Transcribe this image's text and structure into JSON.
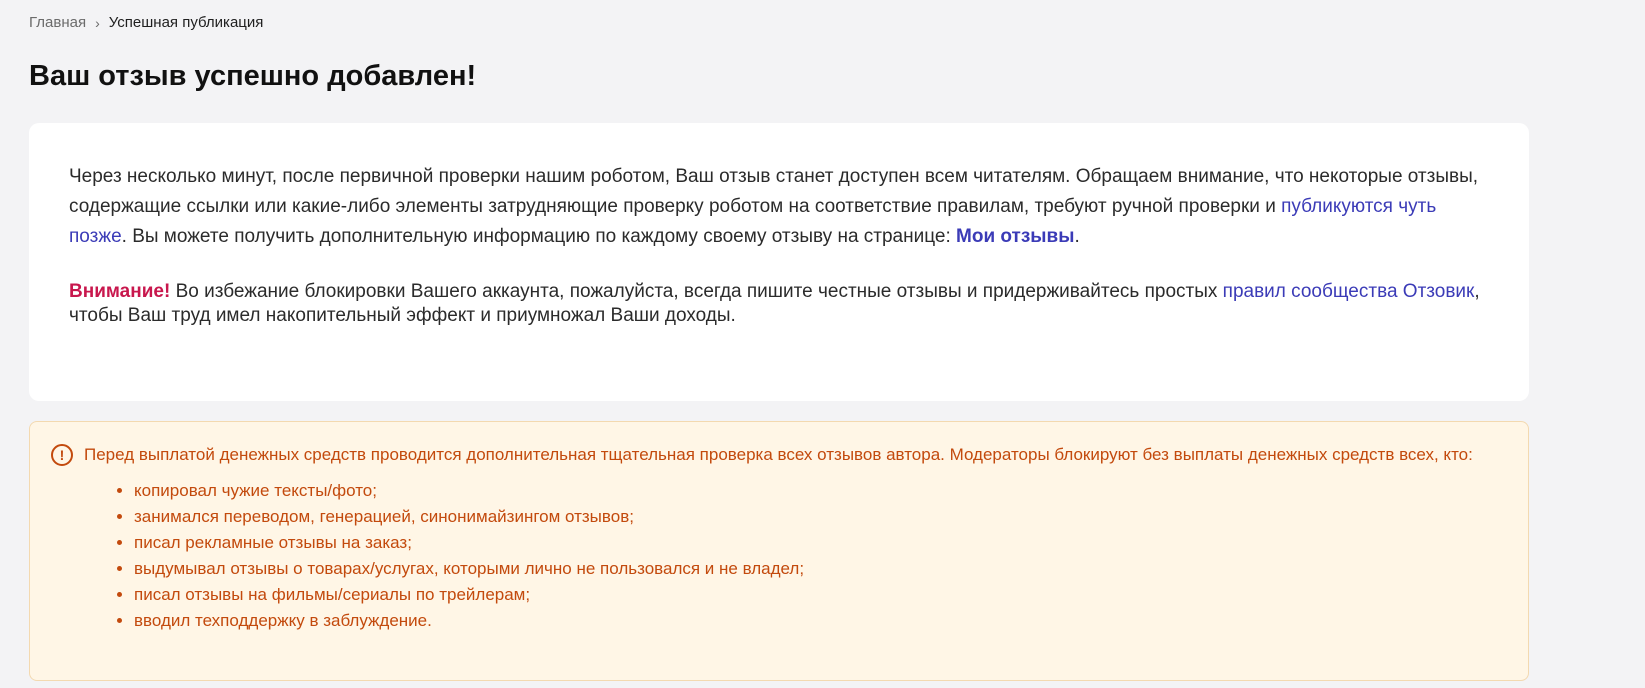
{
  "breadcrumb": {
    "home": "Главная",
    "separator": "›",
    "current": "Успешная публикация"
  },
  "page_title": "Ваш отзыв успешно добавлен!",
  "info": {
    "text1": "Через несколько минут, после первичной проверки нашим роботом, Ваш отзыв станет доступен всем читателям. Обращаем внимание, что некоторые отзывы, содержащие ссылки или какие-либо элементы затрудняющие проверку роботом на соответствие правилам, требуют ручной проверки и ",
    "link_later": "публикуются чуть позже",
    "text2": ". Вы можете получить дополнительную информацию по каждому своему отзыву на странице: ",
    "link_my_reviews": "Мои отзывы",
    "text3": "."
  },
  "notice": {
    "warning_label": "Внимание!",
    "text1": " Во избежание блокировки Вашего аккаунта, пожалуйста, всегда пишите честные отзывы и придерживайтесь простых ",
    "link_rules": "правил сообщества Отзовик",
    "text2": ", чтобы Ваш труд имел накопительный эффект и приумножал Ваши доходы."
  },
  "alert": {
    "icon": "exclamation-circle-icon",
    "intro": "Перед выплатой денежных средств проводится дополнительная тщательная проверка всех отзывов автора. Модераторы блокируют без выплаты денежных средств всех, кто:",
    "items": [
      "копировал чужие тексты/фото;",
      "занимался переводом, генерацией, синонимайзингом отзывов;",
      "писал рекламные отзывы на заказ;",
      "выдумывал отзывы о товарах/услугах, которыми лично не пользовался и не владел;",
      "писал отзывы на фильмы/сериалы по трейлерам;",
      "вводил техподдержку в заблуждение."
    ]
  },
  "colors": {
    "background": "#f3f3f5",
    "link": "#3b3bb7",
    "warning": "#c8174d",
    "alert_text": "#c34a0d",
    "alert_bg": "#fff6e6"
  }
}
